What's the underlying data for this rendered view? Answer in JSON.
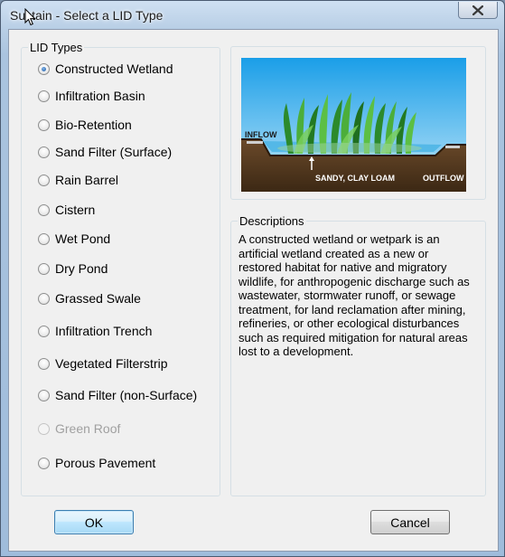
{
  "window": {
    "title": "Sustain - Select a LID Type"
  },
  "lid_types": {
    "label": "LID Types",
    "selected": "Constructed Wetland",
    "options": [
      {
        "label": "Constructed Wetland",
        "checked": true,
        "disabled": false
      },
      {
        "label": "Infiltration Basin",
        "checked": false,
        "disabled": false
      },
      {
        "label": "Bio-Retention",
        "checked": false,
        "disabled": false
      },
      {
        "label": "Sand Filter (Surface)",
        "checked": false,
        "disabled": false
      },
      {
        "label": "Rain Barrel",
        "checked": false,
        "disabled": false
      },
      {
        "label": "Cistern",
        "checked": false,
        "disabled": false
      },
      {
        "label": "Wet Pond",
        "checked": false,
        "disabled": false
      },
      {
        "label": "Dry Pond",
        "checked": false,
        "disabled": false
      },
      {
        "label": "Grassed Swale",
        "checked": false,
        "disabled": false
      },
      {
        "label": "Infiltration Trench",
        "checked": false,
        "disabled": false
      },
      {
        "label": "Vegetated Filterstrip",
        "checked": false,
        "disabled": false
      },
      {
        "label": "Sand Filter (non-Surface)",
        "checked": false,
        "disabled": false
      },
      {
        "label": "Green Roof",
        "checked": false,
        "disabled": true
      },
      {
        "label": "Porous Pavement",
        "checked": false,
        "disabled": false
      }
    ]
  },
  "illustration": {
    "inflow_label": "INFLOW",
    "soil_label": "SANDY, CLAY LOAM",
    "outflow_label": "OUTFLOW"
  },
  "descriptions": {
    "label": "Descriptions",
    "lines": [
      "A constructed wetland or wetpark is an",
      "artificial wetland created as a new or",
      "restored habitat for native and migratory",
      "wildlife, for anthropogenic discharge such as",
      "wastewater, stormwater runoff, or sewage",
      "treatment, for land reclamation after mining,",
      "refineries, or other ecological disturbances",
      "such as required mitigation for natural areas",
      "lost to a development."
    ]
  },
  "buttons": {
    "ok": "OK",
    "cancel": "Cancel"
  },
  "icons": {
    "close": "close-icon",
    "cursor": "mouse-pointer-icon"
  }
}
